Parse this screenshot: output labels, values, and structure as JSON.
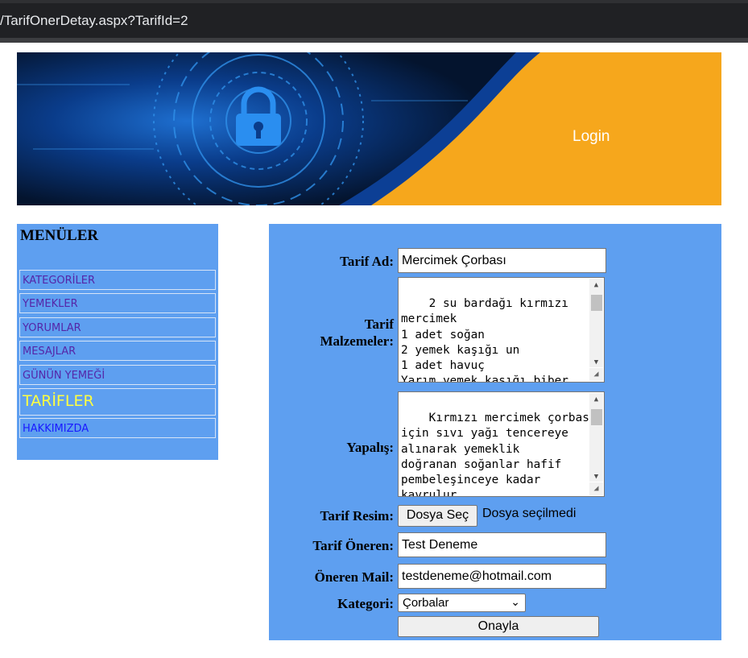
{
  "browser": {
    "url": "/TarifOnerDetay.aspx?TarifId=2"
  },
  "banner": {
    "login_label": "Login",
    "accent_color": "#f6a71c"
  },
  "menu": {
    "title": "MENÜLER",
    "items": [
      {
        "label": "KATEGORİLER"
      },
      {
        "label": "YEMEKLER"
      },
      {
        "label": "YORUMLAR"
      },
      {
        "label": "MESAJLAR"
      },
      {
        "label": "GÜNÜN YEMEĞİ"
      },
      {
        "label": "TARİFLER"
      },
      {
        "label": "HAKKIMIZDA"
      }
    ]
  },
  "form": {
    "name_label": "Tarif Ad:",
    "name_value": "Mercimek Çorbası",
    "ingredients_label_1": "Tarif",
    "ingredients_label_2": "Malzemeler:",
    "ingredients_value": "2 su bardağı kırmızı\nmercimek\n1 adet soğan\n2 yemek kaşığı un\n1 adet havuç\nYarım yemek kaşığı biber\nya da  domates salçası",
    "steps_label": "Yapalış:",
    "steps_value": "Kırmızı mercimek çorbası\niçin sıvı yağı tencereye\nalınarak yemeklik\ndoğranan soğanlar hafif\npembeleşinceye kadar\nkavrulur.\nDaha sonra un ilave",
    "image_label": "Tarif Resim:",
    "file_button": "Dosya Seç",
    "file_status": "Dosya seçilmedi",
    "suggester_label": "Tarif Öneren:",
    "suggester_value": "Test Deneme",
    "mail_label": "Öneren Mail:",
    "mail_value": "testdeneme@hotmail.com",
    "category_label": "Kategori:",
    "category_value": "Çorbalar",
    "submit_label": "Onayla"
  }
}
